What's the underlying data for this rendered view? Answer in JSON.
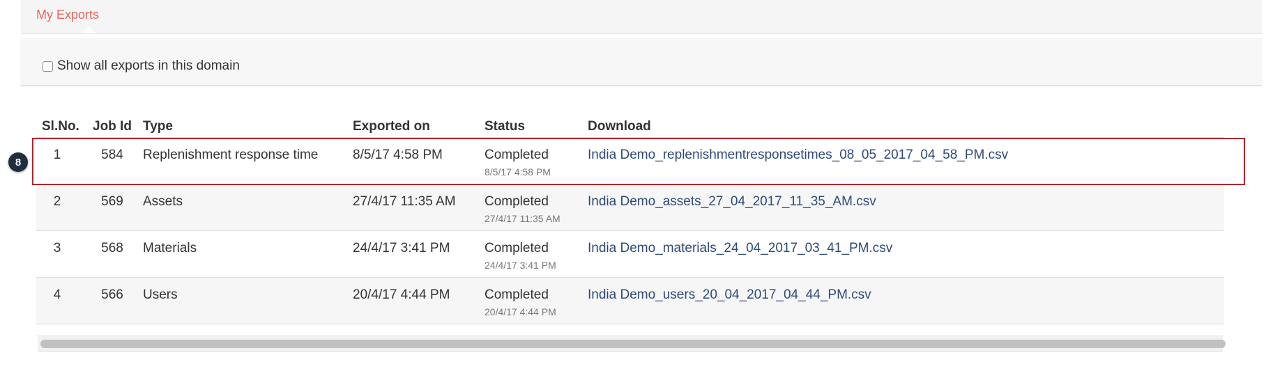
{
  "tabs": {
    "active_label": "My Exports"
  },
  "filter": {
    "show_all_label": "Show all exports in this domain",
    "checked": false
  },
  "table": {
    "columns": [
      "Sl.No.",
      "Job Id",
      "Type",
      "Exported on",
      "Status",
      "Download"
    ],
    "rows": [
      {
        "sl": "1",
        "job_id": "584",
        "type": "Replenishment response time",
        "exported_on": "8/5/17 4:58 PM",
        "status": "Completed",
        "status_time": "8/5/17 4:58 PM",
        "download": "India Demo_replenishmentresponsetimes_08_05_2017_04_58_PM.csv"
      },
      {
        "sl": "2",
        "job_id": "569",
        "type": "Assets",
        "exported_on": "27/4/17 11:35 AM",
        "status": "Completed",
        "status_time": "27/4/17 11:35 AM",
        "download": "India Demo_assets_27_04_2017_11_35_AM.csv"
      },
      {
        "sl": "3",
        "job_id": "568",
        "type": "Materials",
        "exported_on": "24/4/17 3:41 PM",
        "status": "Completed",
        "status_time": "24/4/17 3:41 PM",
        "download": "India Demo_materials_24_04_2017_03_41_PM.csv"
      },
      {
        "sl": "4",
        "job_id": "566",
        "type": "Users",
        "exported_on": "20/4/17 4:44 PM",
        "status": "Completed",
        "status_time": "20/4/17 4:44 PM",
        "download": "India Demo_users_20_04_2017_04_44_PM.csv"
      }
    ]
  },
  "annotation": {
    "step_number": "8"
  },
  "colors": {
    "tab_accent": "#e4665c",
    "link": "#2d4a7a",
    "highlight": "#b3262d",
    "badge": "#1f2d3d"
  }
}
